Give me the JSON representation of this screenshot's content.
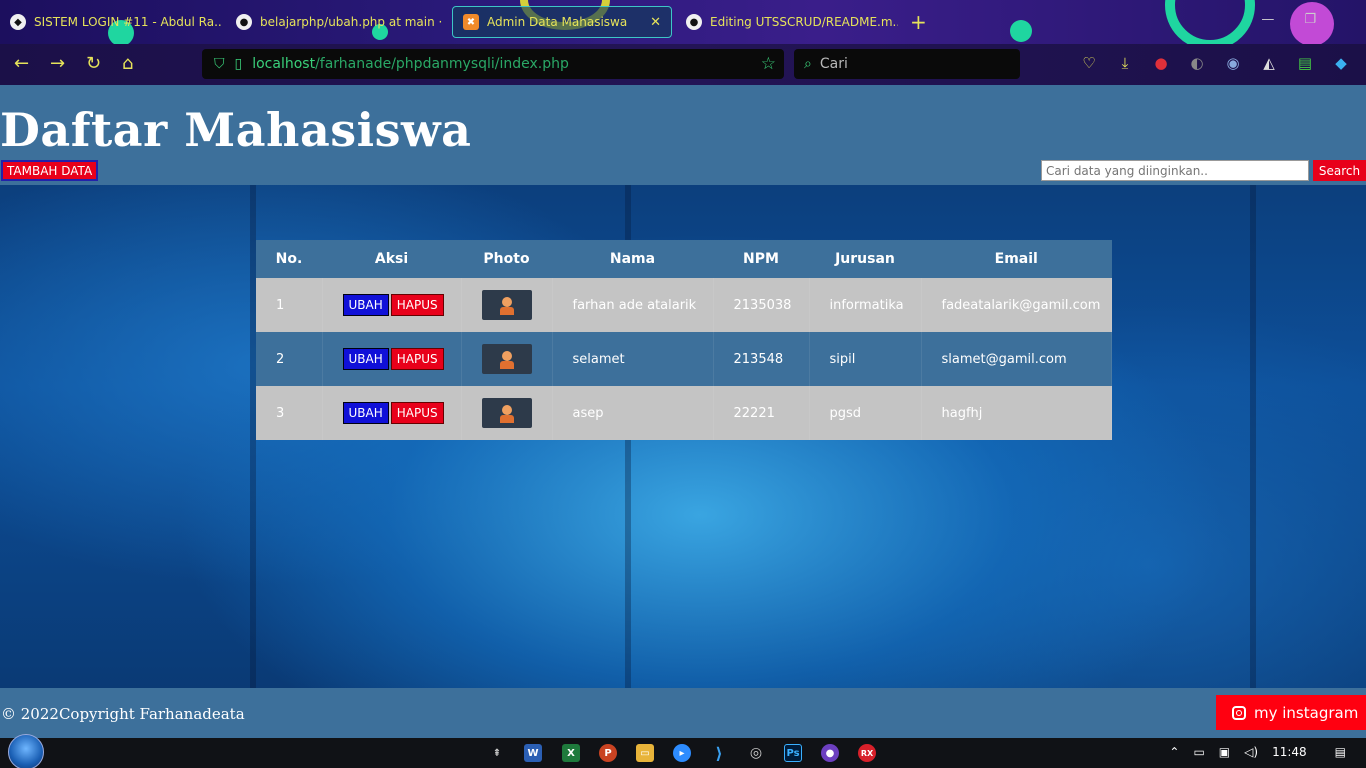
{
  "browser": {
    "tabs": [
      {
        "label": "SISTEM LOGIN #11 - Abdul Ra...",
        "active": false
      },
      {
        "label": "belajarphp/ubah.php at main ·",
        "active": false
      },
      {
        "label": "Admin Data Mahasiswa",
        "active": true
      },
      {
        "label": "Editing UTSSCRUD/README.m...",
        "active": false
      }
    ],
    "url_host": "localhost",
    "url_path": "/farhanade/phpdanmysqli/index.php",
    "search_placeholder": "Cari"
  },
  "page": {
    "title": "Daftar Mahasiswa",
    "add_button": "TAMBAH DATA",
    "search_placeholder": "Cari data yang diinginkan..",
    "search_button": "Search"
  },
  "table": {
    "headers": [
      "No.",
      "Aksi",
      "Photo",
      "Nama",
      "NPM",
      "Jurusan",
      "Email"
    ],
    "edit_label": "UBAH",
    "delete_label": "HAPUS",
    "rows": [
      {
        "no": "1",
        "nama": "farhan ade atalarik",
        "npm": "2135038",
        "jurusan": "informatika",
        "email": "fadeatalarik@gamil.com"
      },
      {
        "no": "2",
        "nama": "selamet",
        "npm": "213548",
        "jurusan": "sipil",
        "email": "slamet@gamil.com"
      },
      {
        "no": "3",
        "nama": "asep",
        "npm": "22221",
        "jurusan": "pgsd",
        "email": "hagfhj"
      }
    ]
  },
  "footer": {
    "copyright": "© 2022Copyright Farhanadeata",
    "instagram_label": "my instagram"
  },
  "taskbar": {
    "time": "11:48"
  },
  "colors": {
    "header_bg": "#3d709b",
    "accent_red": "#e8001a",
    "edit_blue": "#1010d8",
    "row_light": "#c4c4c4"
  }
}
